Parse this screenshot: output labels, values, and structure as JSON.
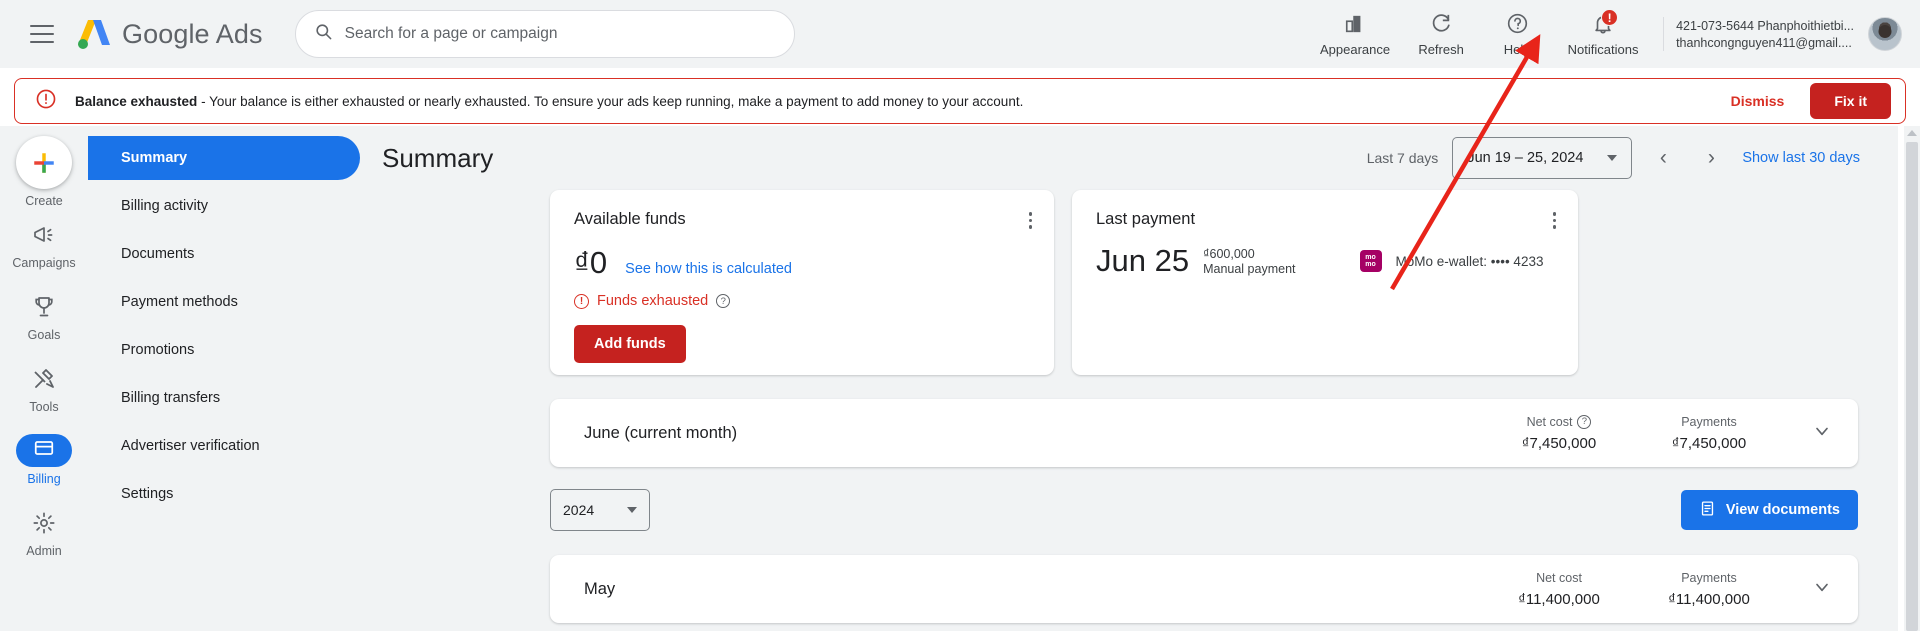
{
  "topbar": {
    "menu_icon": "hamburger-icon",
    "brand": "Google",
    "brand_suffix": "Ads",
    "search_placeholder": "Search for a page or campaign",
    "search_value": "",
    "tools": [
      {
        "label": "Appearance",
        "icon": "appearance-icon"
      },
      {
        "label": "Refresh",
        "icon": "refresh-icon"
      },
      {
        "label": "Help",
        "icon": "help-icon"
      },
      {
        "label": "Notifications",
        "icon": "bell-icon",
        "badge": "!"
      }
    ],
    "account_id": "421-073-5644 Phanphoithietbi...",
    "account_email": "thanhcongnguyen411@gmail...."
  },
  "banner": {
    "icon": "alert-icon",
    "title": "Balance exhausted",
    "message": " - Your balance is either exhausted or nearly exhausted. To ensure your ads keep running, make a payment to add money to your account.",
    "dismiss_label": "Dismiss",
    "fix_label": "Fix it",
    "color": "#d93025"
  },
  "rail": {
    "items": [
      {
        "label": "Create",
        "icon": "plus-icon",
        "active": false
      },
      {
        "label": "Campaigns",
        "icon": "megaphone-icon",
        "active": false
      },
      {
        "label": "Goals",
        "icon": "trophy-icon",
        "active": false
      },
      {
        "label": "Tools",
        "icon": "tools-icon",
        "active": false
      },
      {
        "label": "Billing",
        "icon": "billing-card-icon",
        "active": true
      },
      {
        "label": "Admin",
        "icon": "gear-icon",
        "active": false
      }
    ]
  },
  "subnav": {
    "items": [
      {
        "label": "Summary",
        "active": true
      },
      {
        "label": "Billing activity",
        "active": false
      },
      {
        "label": "Documents",
        "active": false
      },
      {
        "label": "Payment methods",
        "active": false
      },
      {
        "label": "Promotions",
        "active": false
      },
      {
        "label": "Billing transfers",
        "active": false
      },
      {
        "label": "Advertiser verification",
        "active": false
      },
      {
        "label": "Settings",
        "active": false
      }
    ]
  },
  "page": {
    "title": "Summary",
    "date_preset_label": "Last 7 days",
    "date_range": "Jun 19 – 25, 2024",
    "prev_arrow": "‹",
    "next_arrow": "›",
    "show_last_30": "Show last 30 days"
  },
  "available_funds": {
    "title": "Available funds",
    "amount": "₫0",
    "calc_link": "See how this is calculated",
    "status": "Funds exhausted",
    "button": "Add funds"
  },
  "last_payment": {
    "title": "Last payment",
    "date": "Jun 25",
    "amount": "₫600,000",
    "type": "Manual payment",
    "method": "MoMo e-wallet: •••• 4233",
    "method_brand": "momo"
  },
  "month_rows": [
    {
      "name": "June (current month)",
      "net_cost_label": "Net cost",
      "net_cost_value": "₫7,450,000",
      "payments_label": "Payments",
      "payments_value": "₫7,450,000",
      "has_help": true
    },
    {
      "name": "May",
      "net_cost_label": "Net cost",
      "net_cost_value": "₫11,400,000",
      "payments_label": "Payments",
      "payments_value": "₫11,400,000",
      "has_help": false
    }
  ],
  "year_bar": {
    "year": "2024",
    "view_documents": "View documents"
  },
  "annotation": {
    "type": "red-arrow",
    "color": "#e8241a",
    "from": "momo-icon-area",
    "to": "help-icon"
  }
}
